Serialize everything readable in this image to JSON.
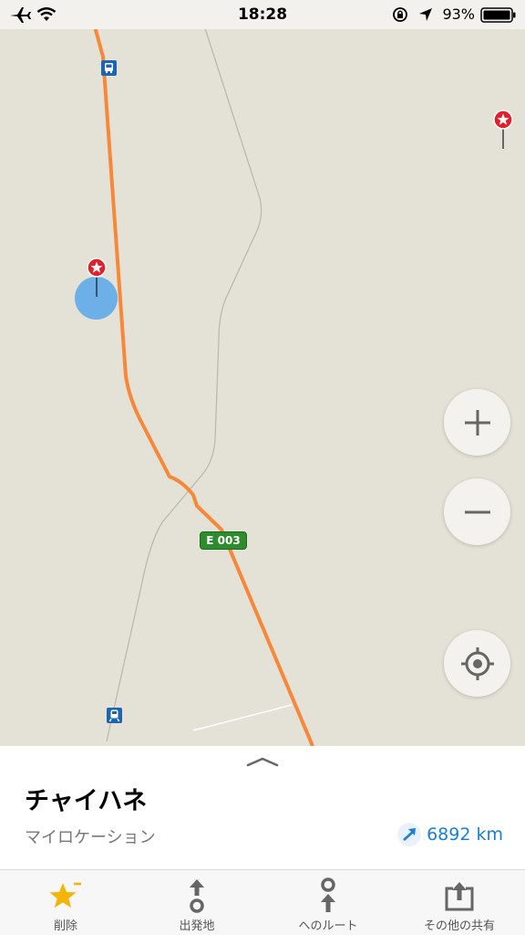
{
  "status_bar": {
    "time": "18:28",
    "battery": "93%"
  },
  "map": {
    "road_shield": "E 003"
  },
  "place": {
    "name": "チャイハネ",
    "subtitle": "マイロケーション",
    "distance": "6892 km"
  },
  "tab_bar": {
    "items": [
      {
        "label": "削除",
        "icon": "star-icon"
      },
      {
        "label": "出発地",
        "icon": "route-from-icon"
      },
      {
        "label": "へのルート",
        "icon": "route-to-icon"
      },
      {
        "label": "その他の共有",
        "icon": "share-icon"
      }
    ]
  },
  "colors": {
    "accent": "#1a7ed6",
    "route": "#f7883a",
    "pin": "#e0202a",
    "star": "#f5b400"
  }
}
